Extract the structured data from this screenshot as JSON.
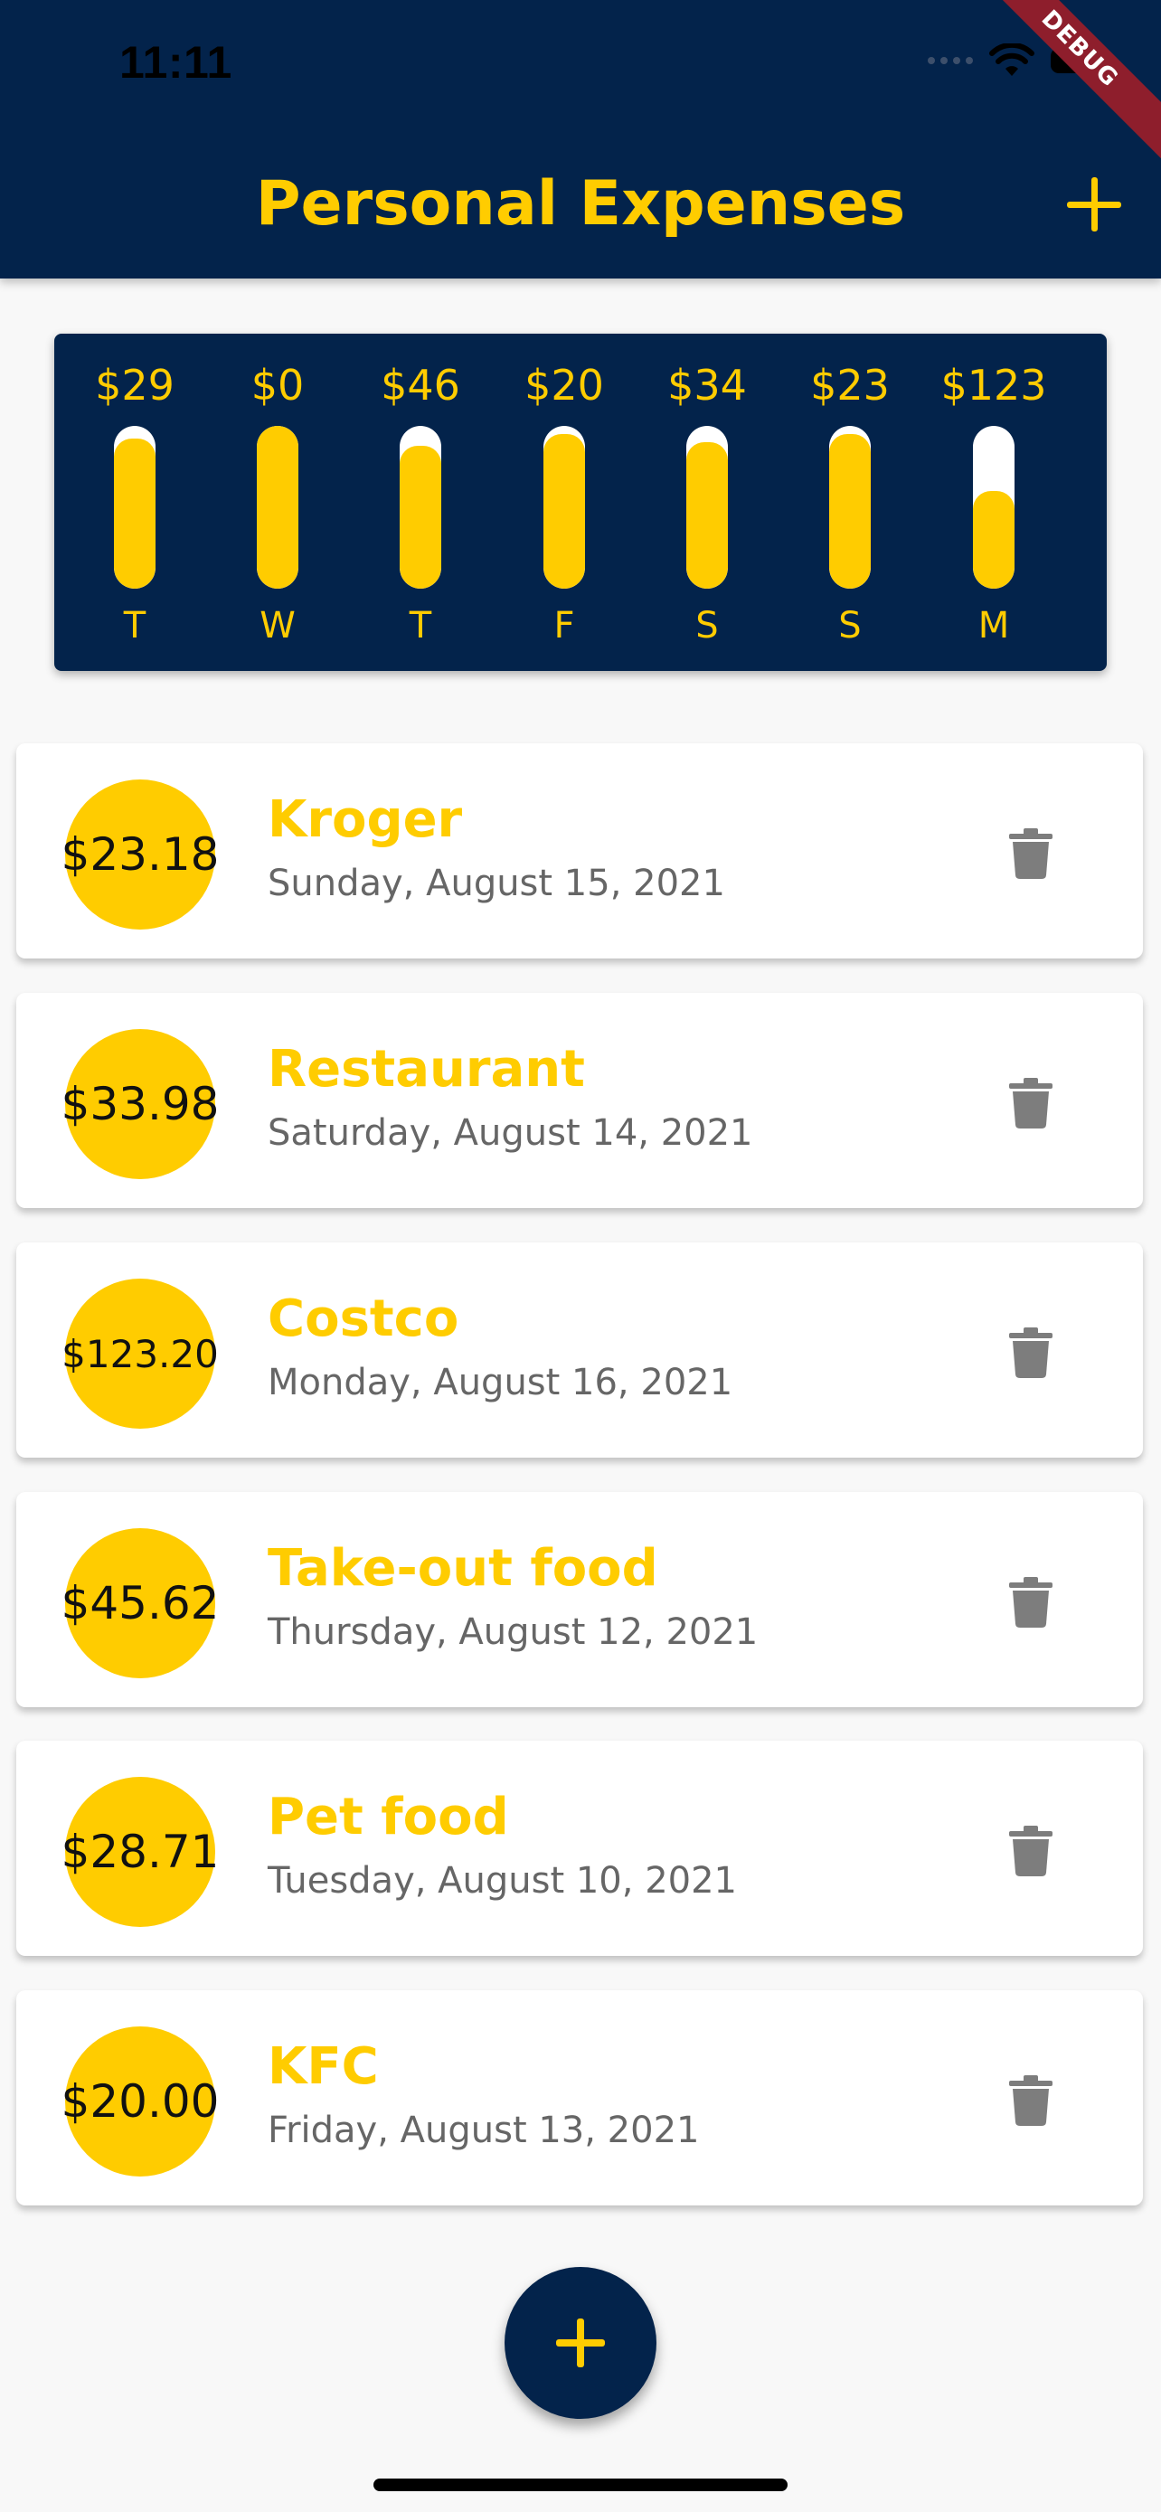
{
  "status_bar": {
    "time": "11:11"
  },
  "app_bar": {
    "title": "Personal Expenses",
    "debug_label": "DEBUG"
  },
  "chart_data": {
    "type": "bar",
    "categories": [
      "T",
      "W",
      "T",
      "F",
      "S",
      "S",
      "M"
    ],
    "labels": [
      "$29",
      "$0",
      "$46",
      "$20",
      "$34",
      "$23",
      "$123"
    ],
    "fill_fraction": [
      0.92,
      1.0,
      0.88,
      0.95,
      0.9,
      0.95,
      0.6
    ],
    "values": [
      29,
      0,
      46,
      20,
      34,
      23,
      123
    ]
  },
  "transactions": [
    {
      "amount": "$23.18",
      "title": "Kroger",
      "date": "Sunday, August 15, 2021"
    },
    {
      "amount": "$33.98",
      "title": "Restaurant",
      "date": "Saturday, August 14, 2021"
    },
    {
      "amount": "$123.20",
      "title": "Costco",
      "date": "Monday, August 16, 2021"
    },
    {
      "amount": "$45.62",
      "title": "Take-out food",
      "date": "Thursday, August 12, 2021"
    },
    {
      "amount": "$28.71",
      "title": "Pet food",
      "date": "Tuesday, August 10, 2021"
    },
    {
      "amount": "$20.00",
      "title": "KFC",
      "date": "Friday, August 13, 2021"
    }
  ],
  "colors": {
    "primary": "#03234b",
    "accent": "#ffcc00"
  }
}
